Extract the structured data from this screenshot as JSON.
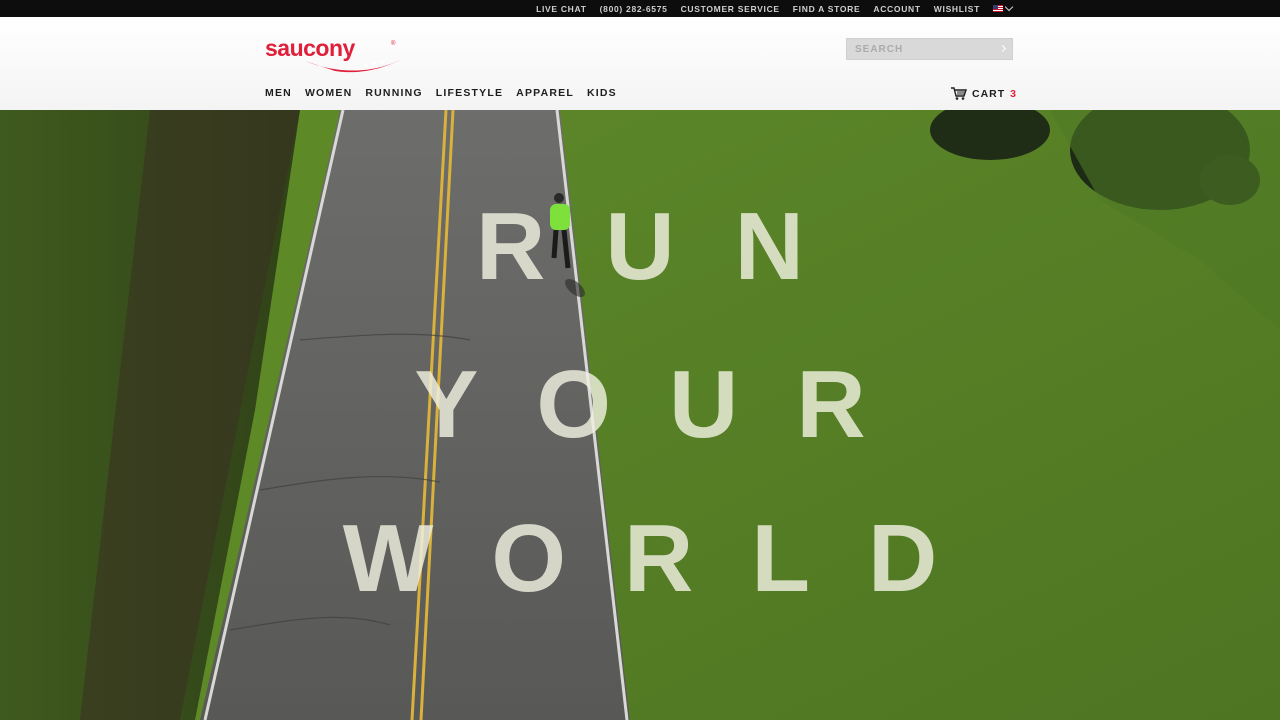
{
  "utility": {
    "live_chat": "LIVE CHAT",
    "phone": "(800) 282-6575",
    "customer_service": "CUSTOMER SERVICE",
    "find_store": "FIND A STORE",
    "account": "ACCOUNT",
    "wishlist": "WISHLIST"
  },
  "brand": {
    "logo_text": "saucony",
    "color": "#e0203a"
  },
  "search": {
    "placeholder": "SEARCH"
  },
  "nav": {
    "men": "MEN",
    "women": "WOMEN",
    "running": "RUNNING",
    "lifestyle": "LIFESTYLE",
    "apparel": "APPAREL",
    "kids": "KIDS"
  },
  "cart": {
    "label": "CART",
    "count": "3"
  },
  "hero": {
    "line1": "RUN",
    "line2": "YOUR",
    "line3": "WORLD"
  }
}
